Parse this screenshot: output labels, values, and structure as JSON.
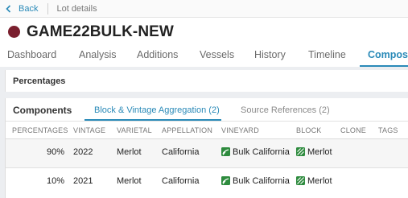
{
  "nav": {
    "back_label": "Back",
    "breadcrumb": "Lot details"
  },
  "lot": {
    "title": "GAME22BULK-NEW",
    "color": "#7a1f2e"
  },
  "tabs": [
    {
      "label": "Dashboard"
    },
    {
      "label": "Analysis"
    },
    {
      "label": "Additions"
    },
    {
      "label": "Vessels"
    },
    {
      "label": "History"
    },
    {
      "label": "Timeline"
    },
    {
      "label": "Composit"
    }
  ],
  "active_tab": "Composit",
  "percentages_panel": {
    "title": "Percentages"
  },
  "components_panel": {
    "title": "Components",
    "subtabs": [
      {
        "label": "Block & Vintage Aggregation (2)"
      },
      {
        "label": "Source References (2)"
      }
    ],
    "columns": [
      "PERCENTAGES",
      "VINTAGE",
      "VARIETAL",
      "APPELLATION",
      "VINEYARD",
      "BLOCK",
      "CLONE",
      "TAGS"
    ],
    "rows": [
      {
        "percentage": "90%",
        "vintage": "2022",
        "varietal": "Merlot",
        "appellation": "California",
        "vineyard": "Bulk California",
        "block": "Merlot",
        "clone": "",
        "tags": ""
      },
      {
        "percentage": "10%",
        "vintage": "2021",
        "varietal": "Merlot",
        "appellation": "California",
        "vineyard": "Bulk California",
        "block": "Merlot",
        "clone": "",
        "tags": ""
      }
    ]
  },
  "colors": {
    "accent": "#2a8ab8",
    "vineyard_icon": "#2e8b3e",
    "block_icon": "#2e8b3e"
  },
  "icons": {
    "back": "chevron-left-icon",
    "vineyard": "vineyard-icon",
    "block": "block-icon"
  }
}
